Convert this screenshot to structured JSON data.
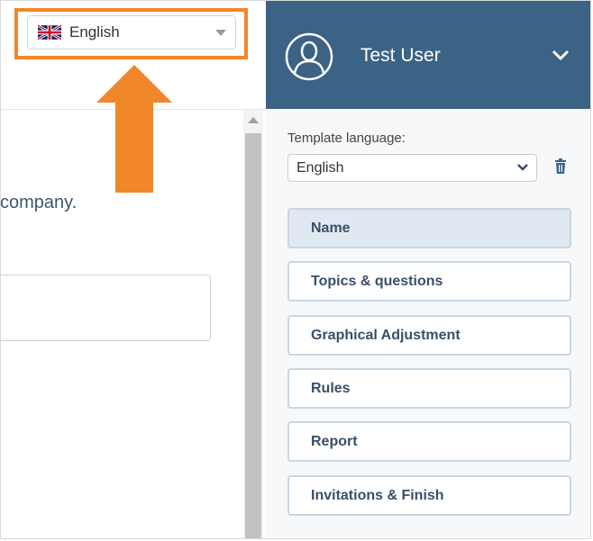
{
  "header": {
    "language_selector": {
      "selected": "English",
      "flag_icon": "uk-flag-icon"
    },
    "user": {
      "name": "Test User",
      "avatar_icon": "user-avatar-icon",
      "menu_icon": "chevron-down-icon"
    }
  },
  "content": {
    "text_fragment": "company."
  },
  "template_panel": {
    "language_label": "Template language:",
    "language_value": "English",
    "delete_icon": "trash-icon",
    "steps": [
      {
        "label": "Name",
        "active": true
      },
      {
        "label": "Topics & questions",
        "active": false
      },
      {
        "label": "Graphical Adjustment",
        "active": false
      },
      {
        "label": "Rules",
        "active": false
      },
      {
        "label": "Report",
        "active": false
      },
      {
        "label": "Invitations & Finish",
        "active": false
      }
    ]
  },
  "colors": {
    "header_bg": "#3c6286",
    "highlight": "#f0872a",
    "nav_border": "#c9d6e2",
    "nav_active_bg": "#e0e9f1"
  }
}
